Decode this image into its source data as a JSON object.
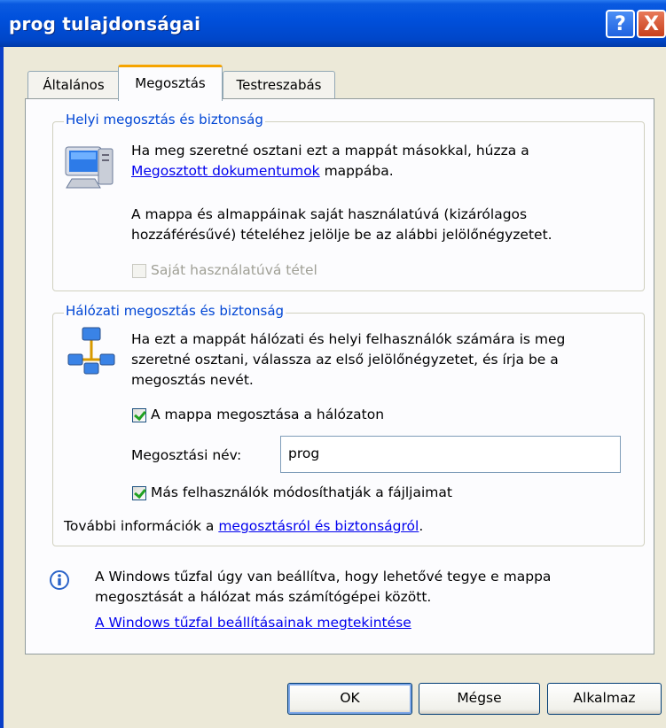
{
  "window": {
    "title": "prog tulajdonságai"
  },
  "title_buttons": {
    "help": "?",
    "close": "X"
  },
  "tabs": [
    {
      "label": "Általános"
    },
    {
      "label": "Megosztás"
    },
    {
      "label": "Testreszabás"
    }
  ],
  "local": {
    "legend": "Helyi megosztás és biztonság",
    "line1": "Ha meg szeretné osztani ezt a mappát másokkal, húzza a",
    "link": "Megosztott dokumentumok",
    "line2_suffix": " mappába.",
    "para2_line1": "A mappa és almappáinak saját használatúvá (kizárólagos",
    "para2_line2": "hozzáférésűvé) tételéhez jelölje be az alábbi jelölőnégyzetet.",
    "private_checkbox": {
      "label": "Saját használatúvá tétel",
      "checked": false,
      "disabled": true
    }
  },
  "network": {
    "legend": "Hálózati megosztás és biztonság",
    "line1": "Ha ezt a mappát hálózati és helyi felhasználók számára is meg",
    "line2": "szeretné osztani, válassza az első jelölőnégyzetet, és írja be a",
    "line3": "megosztás nevét.",
    "share_checkbox": {
      "label": "A mappa megosztása a hálózaton",
      "checked": true
    },
    "share_name_label": "Megosztási név:",
    "share_name_value": "prog",
    "modify_checkbox": {
      "label": "Más felhasználók módosíthatják a fájljaimat",
      "checked": true
    },
    "more_info_prefix": "További információk a ",
    "more_info_link": "megosztásról és biztonságról",
    "more_info_suffix": "."
  },
  "firewall": {
    "line1": "A Windows tűzfal úgy van beállítva, hogy lehetővé tegye e mappa",
    "line2": "megosztását a hálózat más számítógépei között.",
    "link": "A Windows tűzfal beállításainak megtekintése"
  },
  "buttons": {
    "ok": "OK",
    "cancel": "Mégse",
    "apply": "Alkalmaz"
  },
  "colors": {
    "titlebar": "#0050dc",
    "legend": "#0046d5",
    "link": "#0000ee",
    "check": "#21a121"
  }
}
